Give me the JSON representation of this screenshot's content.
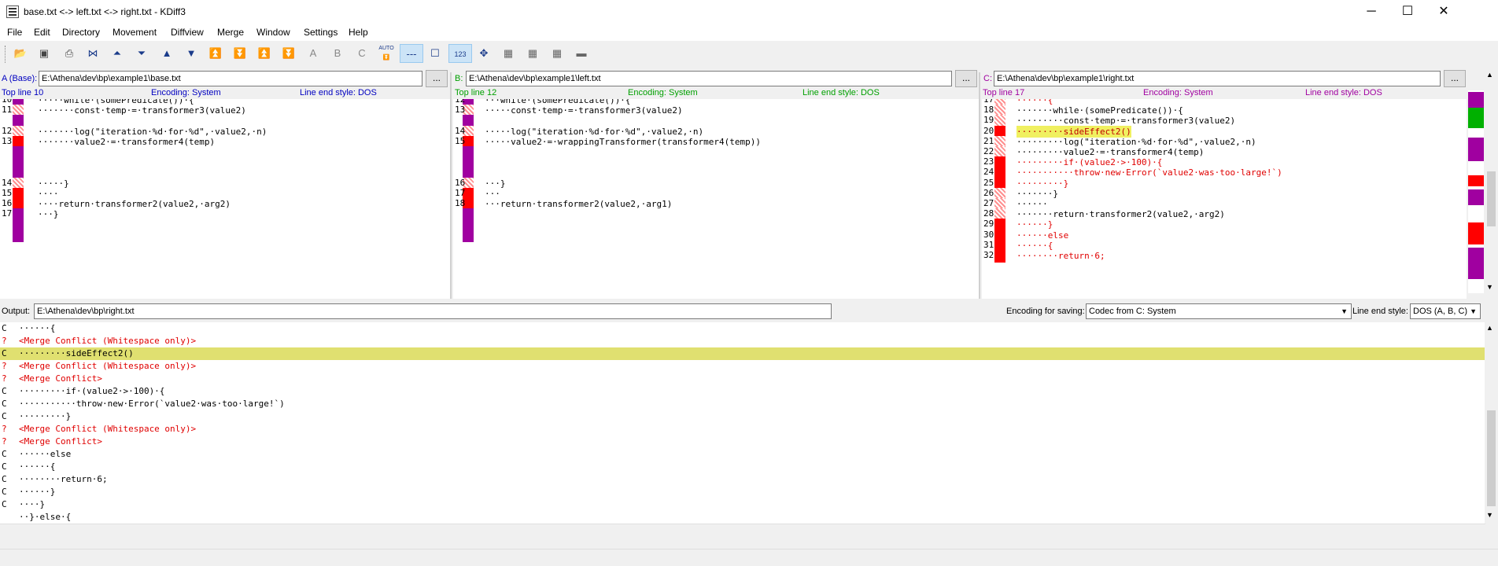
{
  "window": {
    "title": "base.txt <-> left.txt <-> right.txt - KDiff3",
    "minimize": "─",
    "maximize": "☐",
    "close": "✕"
  },
  "menu": [
    "File",
    "Edit",
    "Directory",
    "Movement",
    "Diffview",
    "Merge",
    "Window",
    "Settings",
    "Help"
  ],
  "toolbar": {
    "auto_label": "AUTO",
    "abc": [
      "A",
      "B",
      "C"
    ],
    "numbers_label": "123"
  },
  "panes": {
    "a": {
      "label": "A (Base):",
      "path": "E:\\Athena\\dev\\bp\\example1\\base.txt",
      "topline": "Top line 10",
      "encoding": "Encoding: System",
      "lineend": "Line end style: DOS",
      "color": "#0000c0",
      "lines": [
        {
          "n": "10",
          "t": "·····while·(somePredicate())·{"
        },
        {
          "n": "11",
          "t": "·······const·temp·=·transformer3(value2)"
        },
        {
          "n": "",
          "t": ""
        },
        {
          "n": "12",
          "t": "·······log(\"iteration·%d·for·%d\",·value2,·n)"
        },
        {
          "n": "13",
          "t": "·······value2·=·transformer4(temp)"
        },
        {
          "n": "",
          "t": ""
        },
        {
          "n": "",
          "t": ""
        },
        {
          "n": "",
          "t": ""
        },
        {
          "n": "14",
          "t": "·····}"
        },
        {
          "n": "15",
          "t": "····"
        },
        {
          "n": "16",
          "t": "····return·transformer2(value2,·arg2)"
        },
        {
          "n": "17",
          "t": "···}"
        }
      ]
    },
    "b": {
      "label": "B:",
      "path": "E:\\Athena\\dev\\bp\\example1\\left.txt",
      "topline": "Top line 12",
      "encoding": "Encoding: System",
      "lineend": "Line end style: DOS",
      "color": "#00a000",
      "lines": [
        {
          "n": "12",
          "t": "···while·(somePredicate())·{"
        },
        {
          "n": "13",
          "t": "·····const·temp·=·transformer3(value2)"
        },
        {
          "n": "",
          "t": ""
        },
        {
          "n": "14",
          "t": "·····log(\"iteration·%d·for·%d\",·value2,·n)"
        },
        {
          "n": "15",
          "t": "·····value2·=·wrappingTransformer(transformer4(temp))"
        },
        {
          "n": "",
          "t": ""
        },
        {
          "n": "",
          "t": ""
        },
        {
          "n": "",
          "t": ""
        },
        {
          "n": "16",
          "t": "···}"
        },
        {
          "n": "17",
          "t": "···"
        },
        {
          "n": "18",
          "t": "···return·transformer2(value2,·arg1)"
        }
      ]
    },
    "c": {
      "label": "C:",
      "path": "E:\\Athena\\dev\\bp\\example1\\right.txt",
      "topline": "Top line 17",
      "encoding": "Encoding: System",
      "lineend": "Line end style: DOS",
      "color": "#a000a0",
      "lines": [
        {
          "n": "17",
          "t": "······{"
        },
        {
          "n": "18",
          "t": "·······while·(somePredicate())·{"
        },
        {
          "n": "19",
          "t": "·········const·temp·=·transformer3(value2)"
        },
        {
          "n": "20",
          "t": "·········sideEffect2()"
        },
        {
          "n": "21",
          "t": "·········log(\"iteration·%d·for·%d\",·value2,·n)"
        },
        {
          "n": "22",
          "t": "·········value2·=·transformer4(temp)"
        },
        {
          "n": "23",
          "t": "·········if·(value2·>·100)·{"
        },
        {
          "n": "24",
          "t": "···········throw·new·Error(`value2·was·too·large!`)"
        },
        {
          "n": "25",
          "t": "·········}"
        },
        {
          "n": "26",
          "t": "·······}"
        },
        {
          "n": "27",
          "t": "······"
        },
        {
          "n": "28",
          "t": "·······return·transformer2(value2,·arg2)"
        },
        {
          "n": "29",
          "t": "······}"
        },
        {
          "n": "30",
          "t": "······else"
        },
        {
          "n": "31",
          "t": "······{"
        },
        {
          "n": "32",
          "t": "········return·6;"
        }
      ]
    }
  },
  "output": {
    "label": "Output:",
    "path": "E:\\Athena\\dev\\bp\\right.txt",
    "enc_label": "Encoding for saving:",
    "enc_value": "Codec from C: System",
    "le_label": "Line end style:",
    "le_value": "DOS (A, B, C)",
    "lines": [
      {
        "s": "C",
        "t": "······{",
        "k": "n"
      },
      {
        "s": "?",
        "t": "<Merge Conflict (Whitespace only)>",
        "k": "c"
      },
      {
        "s": "C",
        "t": "·········sideEffect2()",
        "k": "h"
      },
      {
        "s": "?",
        "t": "<Merge Conflict (Whitespace only)>",
        "k": "c"
      },
      {
        "s": "?",
        "t": "<Merge Conflict>",
        "k": "c"
      },
      {
        "s": "C",
        "t": "·········if·(value2·>·100)·{",
        "k": "n"
      },
      {
        "s": "C",
        "t": "···········throw·new·Error(`value2·was·too·large!`)",
        "k": "n"
      },
      {
        "s": "C",
        "t": "·········}",
        "k": "n"
      },
      {
        "s": "?",
        "t": "<Merge Conflict (Whitespace only)>",
        "k": "c"
      },
      {
        "s": "?",
        "t": "<Merge Conflict>",
        "k": "c"
      },
      {
        "s": "C",
        "t": "······else",
        "k": "n"
      },
      {
        "s": "C",
        "t": "······{",
        "k": "n"
      },
      {
        "s": "C",
        "t": "········return·6;",
        "k": "n"
      },
      {
        "s": "C",
        "t": "······}",
        "k": "n"
      },
      {
        "s": "C",
        "t": "····}",
        "k": "n"
      },
      {
        "s": "",
        "t": "··}·else·{",
        "k": "n"
      }
    ]
  }
}
